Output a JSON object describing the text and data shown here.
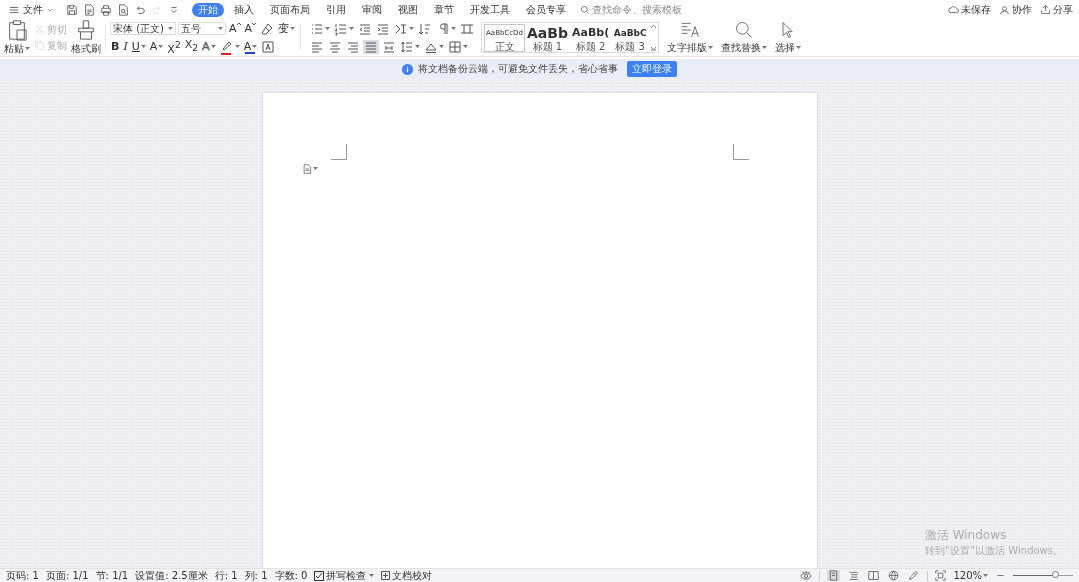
{
  "menu": {
    "label": "文件"
  },
  "quick_access": [
    {
      "kind": "save",
      "disabled": false
    },
    {
      "kind": "pdf",
      "disabled": false
    },
    {
      "kind": "print",
      "disabled": false
    },
    {
      "kind": "preview",
      "disabled": false
    },
    {
      "kind": "undo",
      "disabled": false
    },
    {
      "kind": "redo",
      "disabled": true
    },
    {
      "kind": "customize",
      "disabled": false
    }
  ],
  "tabs": [
    {
      "label": "开始",
      "selected": true
    },
    {
      "label": "插入",
      "selected": false
    },
    {
      "label": "页面布局",
      "selected": false
    },
    {
      "label": "引用",
      "selected": false
    },
    {
      "label": "审阅",
      "selected": false
    },
    {
      "label": "视图",
      "selected": false
    },
    {
      "label": "章节",
      "selected": false
    },
    {
      "label": "开发工具",
      "selected": false
    },
    {
      "label": "会员专享",
      "selected": false
    }
  ],
  "search": {
    "placeholder": "查找命令、搜索模板"
  },
  "account": [
    {
      "label": "未保存",
      "kind": "cloud"
    },
    {
      "label": "协作",
      "kind": "person"
    },
    {
      "label": "分享",
      "kind": "share"
    }
  ],
  "clipboard": {
    "paste": "粘贴",
    "painter": "格式刷",
    "small": [
      {
        "label": "剪切",
        "kind": "cut",
        "disabled": true
      },
      {
        "label": "复制",
        "kind": "copy",
        "disabled": true
      }
    ]
  },
  "font": {
    "name": "宋体 (正文)",
    "size": "五号"
  },
  "font_row1": [
    {
      "kind": "grow",
      "text": "A",
      "dropdown": false
    },
    {
      "kind": "shrink",
      "text": "A",
      "dropdown": false
    },
    {
      "kind": "clear",
      "dropdown": false
    },
    {
      "kind": "phonetic",
      "text": "变",
      "dropdown": true
    }
  ],
  "font_row2": [
    {
      "kind": "bold",
      "text": "B",
      "dropdown": false
    },
    {
      "kind": "italic",
      "text": "I",
      "dropdown": false
    },
    {
      "kind": "underline",
      "text": "U",
      "dropdown": true
    },
    {
      "kind": "strike",
      "text": "A",
      "dropdown": true
    },
    {
      "kind": "superscript",
      "text": "X$^{2}$",
      "dropdown": false
    },
    {
      "kind": "subscript",
      "text": "X$_{2}$",
      "dropdown": false
    },
    {
      "kind": "effect",
      "text": "A",
      "dropdown": true
    },
    {
      "kind": "highlight",
      "dropdown": true
    },
    {
      "kind": "color",
      "text": "A",
      "dropdown": true
    },
    {
      "kind": "charborder",
      "dropdown": false
    }
  ],
  "para_row1": [
    {
      "kind": "bullets",
      "dropdown": true
    },
    {
      "kind": "numbering",
      "dropdown": true
    },
    {
      "kind": "outdent",
      "dropdown": false
    },
    {
      "kind": "indent",
      "dropdown": false
    },
    {
      "kind": "cnlayout",
      "dropdown": true
    },
    {
      "kind": "sort",
      "dropdown": false
    },
    {
      "kind": "marks",
      "dropdown": true
    },
    {
      "kind": "tabs",
      "dropdown": false
    }
  ],
  "align": [
    {
      "kind": "left",
      "selected": false
    },
    {
      "kind": "center",
      "selected": false
    },
    {
      "kind": "right",
      "selected": false
    },
    {
      "kind": "justify",
      "selected": true
    },
    {
      "kind": "distribute",
      "selected": false
    }
  ],
  "para_row2": [
    {
      "kind": "linespacing",
      "dropdown": true
    },
    {
      "kind": "shading",
      "dropdown": true
    },
    {
      "kind": "borders",
      "dropdown": true
    }
  ],
  "styles": [
    {
      "sample": "AaBbCcDd",
      "label": "正文",
      "kind": "body",
      "selected": true
    },
    {
      "sample": "AaBb",
      "label": "标题 1",
      "kind": "h1",
      "selected": false
    },
    {
      "sample": "AaBb(",
      "label": "标题 2",
      "kind": "h2",
      "selected": false
    },
    {
      "sample": "AaBbC",
      "label": "标题 3",
      "kind": "h3",
      "selected": false
    }
  ],
  "tools": [
    {
      "label": "文字排版",
      "kind": "layout"
    },
    {
      "label": "查找替换",
      "kind": "find"
    },
    {
      "label": "选择",
      "kind": "select"
    }
  ],
  "notice": {
    "text": "将文档备份云端，可避免文件丢失，省心省事",
    "button": "立即登录"
  },
  "activation": {
    "title": "激活 Windows",
    "text": "转到“设置”以激活 Windows。"
  },
  "status": {
    "items": [
      "页码: 1",
      "页面: 1/1",
      "节: 1/1",
      "设置值: 2.5厘米",
      "行: 1",
      "列: 1",
      "字数: 0"
    ],
    "spell_check": {
      "label": "拼写检查",
      "checked": true
    },
    "proofread": "文档校对",
    "views": [
      {
        "kind": "page",
        "selected": true
      },
      {
        "kind": "outline",
        "selected": false
      },
      {
        "kind": "read",
        "selected": false
      },
      {
        "kind": "web",
        "selected": false
      },
      {
        "kind": "pen",
        "selected": false
      }
    ],
    "zoom": "120%",
    "zoom_slider": {
      "level": 0.72
    }
  }
}
